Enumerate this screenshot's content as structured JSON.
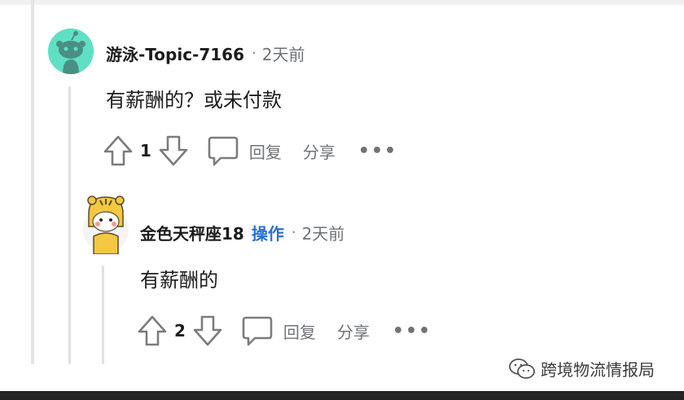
{
  "comments": [
    {
      "author": "游泳-Topic-7166",
      "op_badge": "",
      "separator": "·",
      "time": "2天前",
      "body": "有薪酬的？或未付款",
      "score": "1",
      "reply_label": "回复",
      "share_label": "分享",
      "more_label": "•••",
      "avatar": "reddit-snoo-avatar-mint"
    },
    {
      "author": "金色天秤座18",
      "op_badge": "操作",
      "separator": "·",
      "time": "2天前",
      "body": "有薪酬的",
      "score": "2",
      "reply_label": "回复",
      "share_label": "分享",
      "more_label": "•••",
      "avatar": "tiger-costume-avatar"
    }
  ],
  "watermark": {
    "text": "跨境物流情报局",
    "icon": "wechat-icon"
  },
  "colors": {
    "op_badge": "#2a6fd6",
    "avatar_mint": "#5fe0c4",
    "icon_gray": "#7c7c7c",
    "thread_line": "#dfe1e3"
  }
}
